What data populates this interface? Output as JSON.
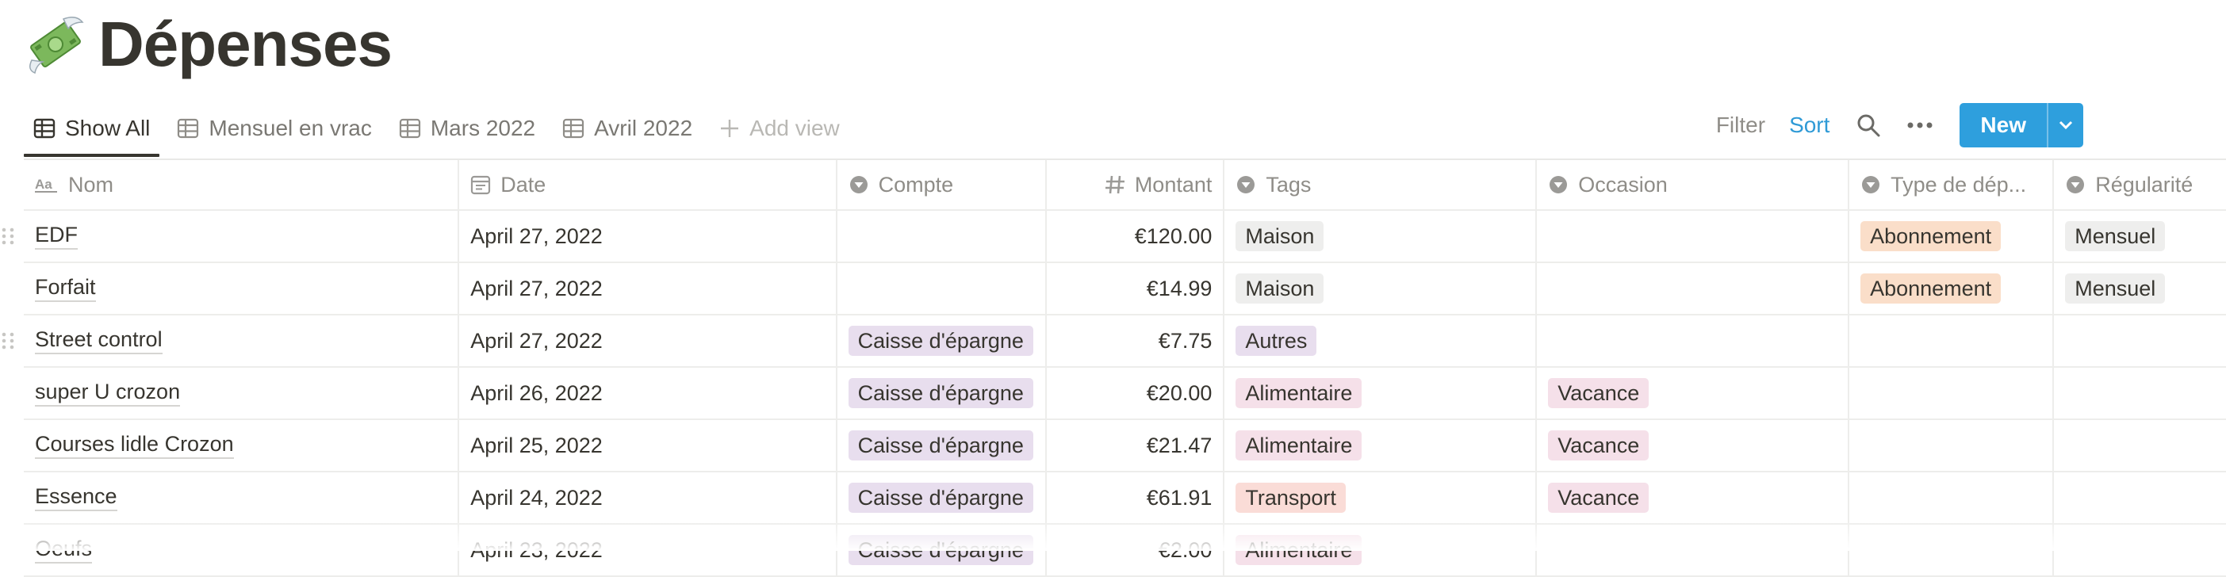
{
  "page": {
    "title": "Dépenses",
    "icon": "money-with-wings-icon"
  },
  "views": [
    {
      "label": "Show All",
      "active": true
    },
    {
      "label": "Mensuel en vrac"
    },
    {
      "label": "Mars 2022"
    },
    {
      "label": "Avril 2022"
    }
  ],
  "add_view_label": "Add view",
  "toolbar": {
    "filter": "Filter",
    "sort": "Sort",
    "new": "New"
  },
  "columns": {
    "nom": "Nom",
    "date": "Date",
    "compte": "Compte",
    "montant": "Montant",
    "tags": "Tags",
    "occasion": "Occasion",
    "type": "Type de dép...",
    "regularite": "Régularité"
  },
  "rows": [
    {
      "nom": "EDF",
      "date": "April 27, 2022",
      "compte": "",
      "montant": "€120.00",
      "tags": "Maison",
      "occasion": "",
      "type": "Abonnement",
      "regularite": "Mensuel"
    },
    {
      "nom": "Forfait",
      "date": "April 27, 2022",
      "compte": "",
      "montant": "€14.99",
      "tags": "Maison",
      "occasion": "",
      "type": "Abonnement",
      "regularite": "Mensuel"
    },
    {
      "nom": "Street control",
      "date": "April 27, 2022",
      "compte": "Caisse d'épargne",
      "montant": "€7.75",
      "tags": "Autres",
      "occasion": "",
      "type": "",
      "regularite": ""
    },
    {
      "nom": "super U crozon",
      "date": "April 26, 2022",
      "compte": "Caisse d'épargne",
      "montant": "€20.00",
      "tags": "Alimentaire",
      "occasion": "Vacance",
      "type": "",
      "regularite": ""
    },
    {
      "nom": "Courses lidle Crozon",
      "date": "April 25, 2022",
      "compte": "Caisse d'épargne",
      "montant": "€21.47",
      "tags": "Alimentaire",
      "occasion": "Vacance",
      "type": "",
      "regularite": ""
    },
    {
      "nom": "Essence",
      "date": "April 24, 2022",
      "compte": "Caisse d'épargne",
      "montant": "€61.91",
      "tags": "Transport",
      "occasion": "Vacance",
      "type": "",
      "regularite": ""
    },
    {
      "nom": "Oeufs",
      "date": "April 23, 2022",
      "compte": "Caisse d'épargne",
      "montant": "€2.00",
      "tags": "Alimentaire",
      "occasion": "",
      "type": "",
      "regularite": ""
    }
  ],
  "tag_colors": {
    "Caisse d'épargne": "#e8deee",
    "Maison": "#eeeeed",
    "Autres": "#e8deee",
    "Alimentaire": "#f5e0e9",
    "Transport": "#fadcd7",
    "Vacance": "#f5e0e9",
    "Abonnement": "#fadec9",
    "Mensuel": "#eeeeed"
  },
  "accent_color": "#2e9fdd"
}
